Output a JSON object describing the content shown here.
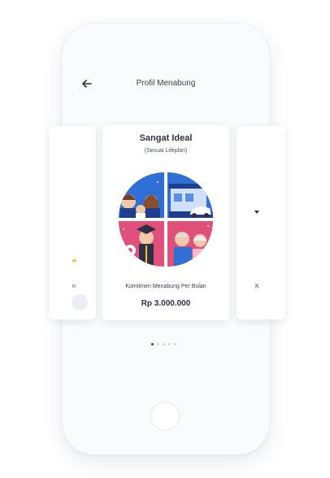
{
  "header": {
    "title": "Profil Menabung",
    "back_icon": "arrow-left-icon"
  },
  "cards": {
    "main": {
      "title": "Sangat Ideal",
      "subtitle": "(Sesuai Lifeplan)",
      "commitment_label": "Komitmen Menabung Per Bulan",
      "amount": "Rp 3.000.000"
    },
    "left_peek_label": "n",
    "right_peek_label": "K"
  },
  "pagination": {
    "total": 5,
    "active_index": 0
  },
  "colors": {
    "blue": "#2f6fd6",
    "pink": "#e14f7b",
    "navy": "#2d3142",
    "yellow": "#f3c43a"
  }
}
